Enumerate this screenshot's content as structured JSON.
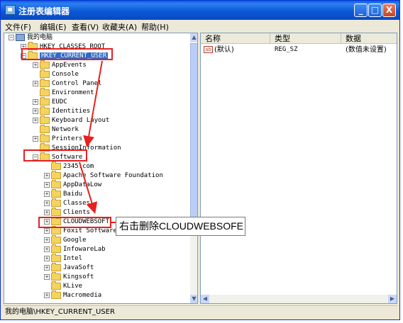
{
  "window": {
    "title": "注册表编辑器"
  },
  "title_buttons": {
    "minimize": "_",
    "maximize": "□",
    "close": "X"
  },
  "menu": [
    "文件(F)",
    "编辑(E)",
    "查看(V)",
    "收藏夹(A)",
    "帮助(H)"
  ],
  "tree": {
    "root": "我的电脑",
    "hkcr": "HKEY_CLASSES_ROOT",
    "hkcu": "HKEY_CURRENT_USER",
    "hkcu_children": [
      "AppEvents",
      "Console",
      "Control Panel",
      "Environment",
      "EUDC",
      "Identities",
      "Keyboard Layout",
      "Network",
      "Printers",
      "SessionInformation",
      "Software"
    ],
    "software_children": [
      "2345.com",
      "Apache Software Foundation",
      "AppDataLow",
      "Baidu",
      "Classes",
      "Clients",
      "CLOUDWEBSOFT",
      "Foxit Software",
      "Google",
      "InfowareLab",
      "Intel",
      "JavaSoft",
      "Kingsoft",
      "KLive",
      "Macromedia"
    ]
  },
  "list": {
    "columns": [
      "名称",
      "类型",
      "数据"
    ],
    "rows": [
      {
        "name": "(默认)",
        "type": "REG_SZ",
        "data": "(数值未设置)",
        "icon": "ab"
      }
    ]
  },
  "statusbar": "我的电脑\\HKEY_CURRENT_USER",
  "annotation": {
    "callout_text": "右击删除CLOUDWEBSOFE",
    "accent": "#e8201e"
  }
}
